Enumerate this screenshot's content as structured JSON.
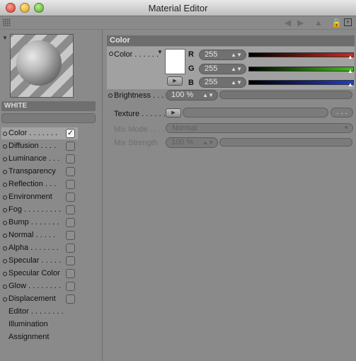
{
  "window": {
    "title": "Material Editor"
  },
  "material": {
    "name": "WHITE"
  },
  "channels": [
    {
      "label": "Color",
      "dots": ". . . . . . .",
      "checked": true
    },
    {
      "label": "Diffusion",
      "dots": ". . . .",
      "checked": false
    },
    {
      "label": "Luminance",
      "dots": ". . .",
      "checked": false
    },
    {
      "label": "Transparency",
      "dots": "",
      "checked": false
    },
    {
      "label": "Reflection",
      "dots": ". . .",
      "checked": false
    },
    {
      "label": "Environment",
      "dots": "",
      "checked": false
    },
    {
      "label": "Fog",
      "dots": ". . . . . . . . .",
      "checked": false
    },
    {
      "label": "Bump",
      "dots": ". . . . . . .",
      "checked": false
    },
    {
      "label": "Normal",
      "dots": ". . . . .",
      "checked": false
    },
    {
      "label": "Alpha",
      "dots": ". . . . . . .",
      "checked": false
    },
    {
      "label": "Specular",
      "dots": ". . . . .",
      "checked": false
    },
    {
      "label": "Specular Color",
      "dots": "",
      "checked": false
    },
    {
      "label": "Glow",
      "dots": ". . . . . . . .",
      "checked": false
    },
    {
      "label": "Displacement",
      "dots": "",
      "checked": false
    }
  ],
  "extra_items": [
    {
      "label": "Editor",
      "dots": ". . . . . . . ."
    },
    {
      "label": "Illumination",
      "dots": ""
    },
    {
      "label": "Assignment",
      "dots": ""
    }
  ],
  "color_section": {
    "header": "Color",
    "color_label": "Color",
    "color_dots": ". . . . . .",
    "swatch_color": "#ffffff",
    "r": {
      "label": "R",
      "value": "255",
      "color": "#cc2a1e"
    },
    "g": {
      "label": "G",
      "value": "255",
      "color": "#44c01a"
    },
    "b": {
      "label": "B",
      "value": "255",
      "color": "#1e3ed0"
    },
    "brightness": {
      "label": "Brightness",
      "dots": ". . .",
      "value": "100 %"
    },
    "texture": {
      "label": "Texture",
      "dots": ". . . . . . .",
      "button": ". . ."
    },
    "mix_mode": {
      "label": "Mix Mode",
      "dots": ". . . .",
      "value": "Normal"
    },
    "mix_strength": {
      "label": "Mix Strength",
      "value": "100 %"
    }
  }
}
